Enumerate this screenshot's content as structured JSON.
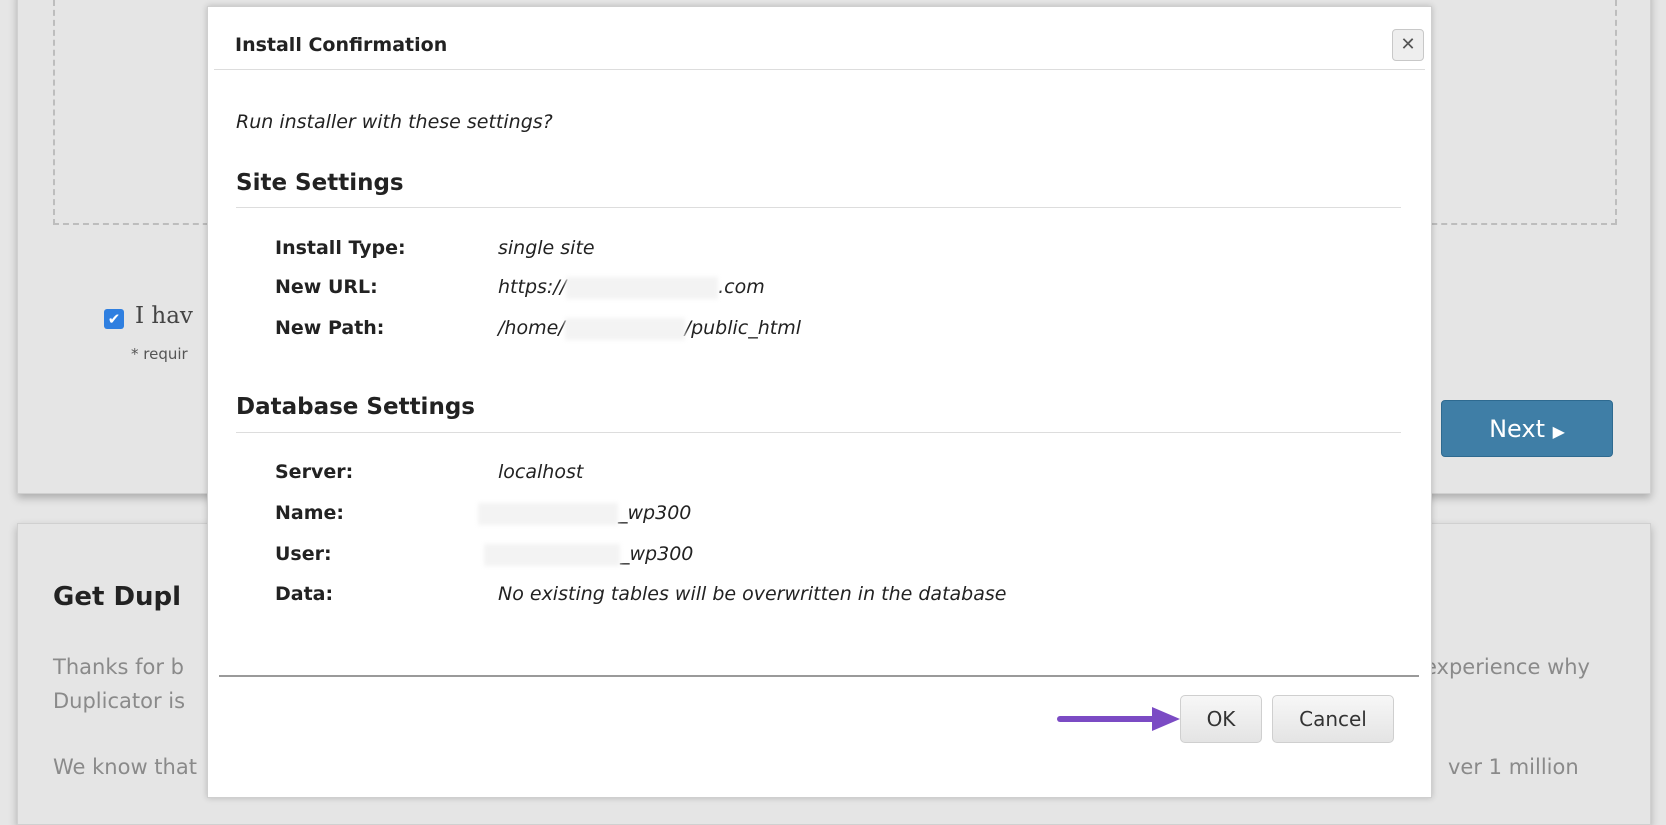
{
  "background": {
    "agree_label": "I hav",
    "required_note": "* requir",
    "next_button": "Next",
    "promo_heading": "Get Dupl",
    "promo_line1_left": "Thanks for b",
    "promo_line1_right": "experience why",
    "promo_line2": "Duplicator is",
    "promo_line3_left": "We know that",
    "promo_line3_right": "ver 1 million",
    "star_color": "#f0a040"
  },
  "modal": {
    "title": "Install Confirmation",
    "close_icon": "close-x-icon",
    "intro": "Run installer with these settings?",
    "site_settings": {
      "heading": "Site Settings",
      "rows": [
        {
          "label": "Install Type:",
          "value": "single site"
        },
        {
          "label": "New URL:",
          "prefix": "https://",
          "suffix": ".com"
        },
        {
          "label": "New Path:",
          "prefix": "/home/",
          "suffix": "/public_html"
        }
      ]
    },
    "database_settings": {
      "heading": "Database Settings",
      "rows": [
        {
          "label": "Server:",
          "value": "localhost"
        },
        {
          "label": "Name:",
          "suffix": "_wp300"
        },
        {
          "label": "User:",
          "suffix": "_wp300"
        },
        {
          "label": "Data:",
          "value": "No existing tables will be overwritten in the database"
        }
      ]
    },
    "ok_button": "OK",
    "cancel_button": "Cancel",
    "arrow_color": "#7b4bc4"
  }
}
